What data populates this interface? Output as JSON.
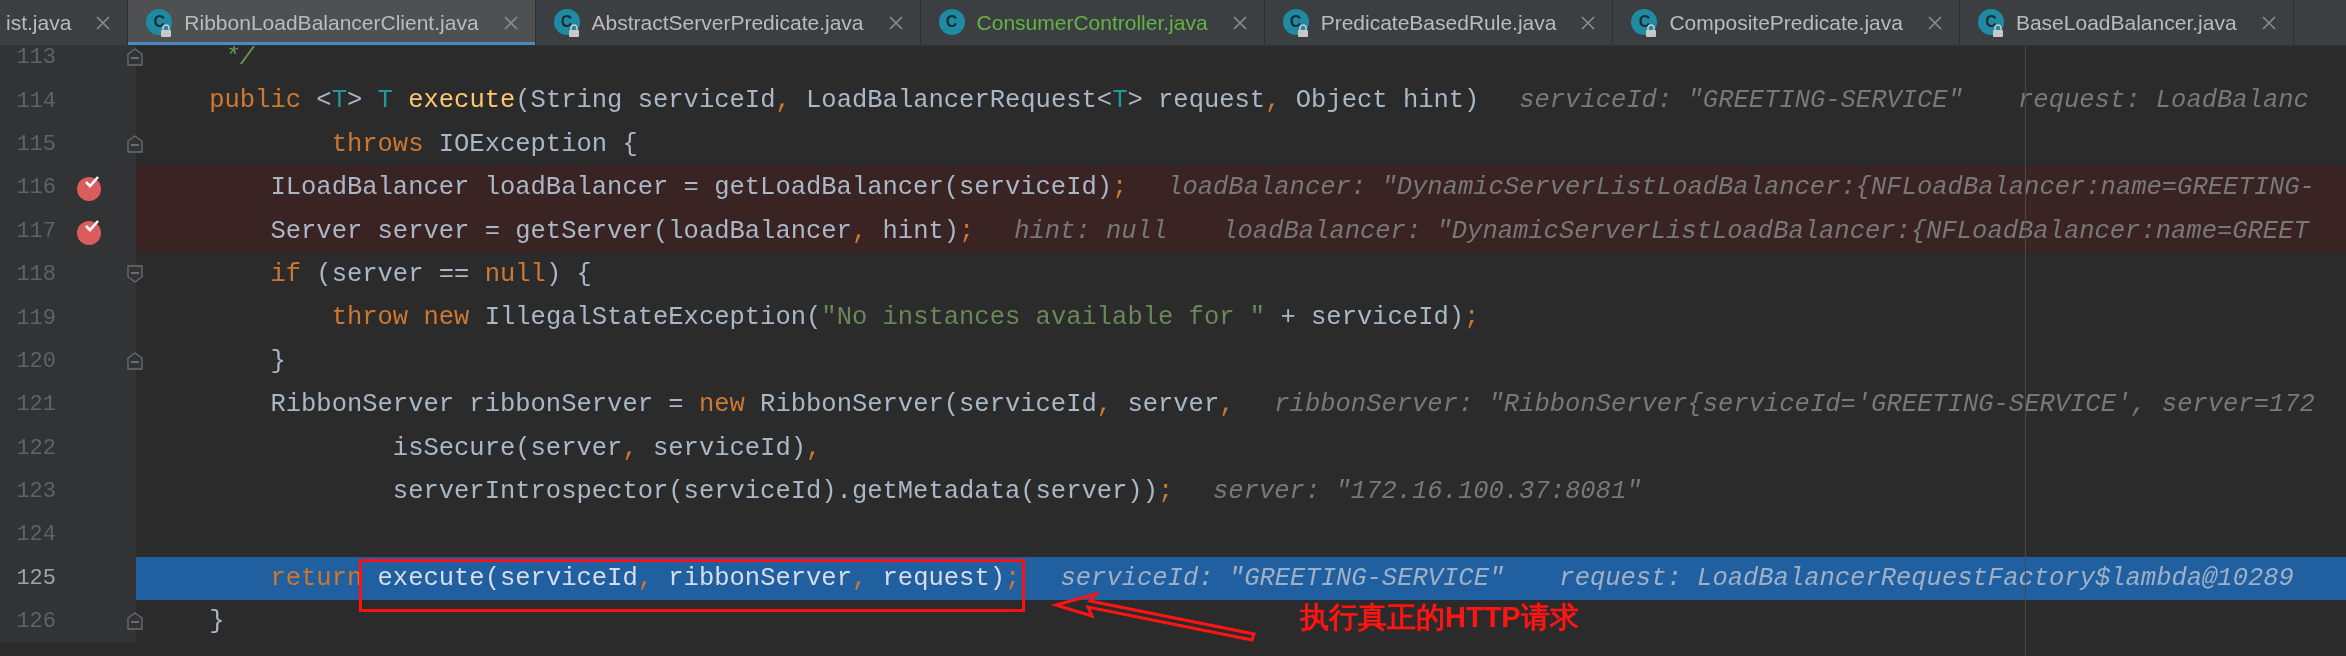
{
  "tabs": [
    {
      "label": "ist.java",
      "selected": false,
      "locked": false,
      "color": "#bbbbbb"
    },
    {
      "label": "RibbonLoadBalancerClient.java",
      "icon": "C",
      "selected": true,
      "locked": true,
      "color": "#bbbbbb"
    },
    {
      "label": "AbstractServerPredicate.java",
      "icon": "C",
      "selected": false,
      "locked": true,
      "color": "#bbbbbb"
    },
    {
      "label": "ConsumerController.java",
      "icon": "C",
      "selected": false,
      "locked": false,
      "color": "#62b543"
    },
    {
      "label": "PredicateBasedRule.java",
      "icon": "C",
      "selected": false,
      "locked": true,
      "color": "#bbbbbb"
    },
    {
      "label": "CompositePredicate.java",
      "icon": "C",
      "selected": false,
      "locked": true,
      "color": "#bbbbbb"
    },
    {
      "label": "BaseLoadBalancer.java",
      "icon": "C",
      "selected": false,
      "locked": true,
      "color": "#bbbbbb"
    }
  ],
  "editor": {
    "lines": [
      {
        "number": "113",
        "current": false,
        "breakpoint": false,
        "fold_start": false,
        "fold_end": true,
        "tokens": [
          {
            "t": "     */",
            "kind": "comment"
          }
        ]
      },
      {
        "number": "114",
        "current": false,
        "breakpoint": false,
        "fold_start": false,
        "fold_end": false,
        "tokens": [
          {
            "t": "    public",
            "kind": "kw"
          },
          {
            "t": " <",
            "kind": "plain"
          },
          {
            "t": "T",
            "kind": "tp"
          },
          {
            "t": "> ",
            "kind": "plain"
          },
          {
            "t": "T",
            "kind": "tp"
          },
          {
            "t": " execute",
            "kind": "fn"
          },
          {
            "t": "(String serviceId",
            "kind": "plain"
          },
          {
            "t": ",",
            "kind": "punct"
          },
          {
            "t": " LoadBalancerRequest<",
            "kind": "plain"
          },
          {
            "t": "T",
            "kind": "tp"
          },
          {
            "t": "> request",
            "kind": "plain"
          },
          {
            "t": ",",
            "kind": "punct"
          },
          {
            "t": " Object hint)",
            "kind": "plain"
          }
        ],
        "hints": [
          "serviceId: \"GREETING-SERVICE\"",
          "request: LoadBalanc"
        ]
      },
      {
        "number": "115",
        "current": false,
        "breakpoint": false,
        "fold_start": false,
        "fold_end": true,
        "tokens": [
          {
            "t": "            throws",
            "kind": "kw"
          },
          {
            "t": " IOException {",
            "kind": "plain"
          }
        ]
      },
      {
        "number": "116",
        "current": false,
        "breakpoint": true,
        "fold_start": false,
        "fold_end": false,
        "tokens": [
          {
            "t": "        ILoadBalancer loadBalancer = getLoadBalancer(serviceId)",
            "kind": "plain"
          },
          {
            "t": ";",
            "kind": "punct"
          }
        ],
        "hints": [
          "loadBalancer: \"DynamicServerListLoadBalancer:{NFLoadBalancer:name=GREETING-"
        ]
      },
      {
        "number": "117",
        "current": false,
        "breakpoint": true,
        "fold_start": false,
        "fold_end": false,
        "tokens": [
          {
            "t": "        Server server = getServer(loadBalancer",
            "kind": "plain"
          },
          {
            "t": ",",
            "kind": "punct"
          },
          {
            "t": " hint)",
            "kind": "plain"
          },
          {
            "t": ";",
            "kind": "punct"
          }
        ],
        "hints": [
          "hint: null",
          "loadBalancer: \"DynamicServerListLoadBalancer:{NFLoadBalancer:name=GREET"
        ]
      },
      {
        "number": "118",
        "current": false,
        "breakpoint": false,
        "fold_start": true,
        "fold_end": false,
        "tokens": [
          {
            "t": "        if",
            "kind": "kw"
          },
          {
            "t": " (server == ",
            "kind": "plain"
          },
          {
            "t": "null",
            "kind": "kw"
          },
          {
            "t": ") {",
            "kind": "plain"
          }
        ]
      },
      {
        "number": "119",
        "current": false,
        "breakpoint": false,
        "fold_start": false,
        "fold_end": false,
        "tokens": [
          {
            "t": "            throw",
            "kind": "kw"
          },
          {
            "t": " new",
            "kind": "kw"
          },
          {
            "t": " IllegalStateException(",
            "kind": "plain"
          },
          {
            "t": "\"No instances available for \"",
            "kind": "str"
          },
          {
            "t": " + serviceId)",
            "kind": "plain"
          },
          {
            "t": ";",
            "kind": "punct"
          }
        ]
      },
      {
        "number": "120",
        "current": false,
        "breakpoint": false,
        "fold_start": false,
        "fold_end": true,
        "tokens": [
          {
            "t": "        }",
            "kind": "plain"
          }
        ]
      },
      {
        "number": "121",
        "current": false,
        "breakpoint": false,
        "fold_start": false,
        "fold_end": false,
        "tokens": [
          {
            "t": "        RibbonServer ribbonServer = ",
            "kind": "plain"
          },
          {
            "t": "new",
            "kind": "kw"
          },
          {
            "t": " RibbonServer(serviceId",
            "kind": "plain"
          },
          {
            "t": ",",
            "kind": "punct"
          },
          {
            "t": " server",
            "kind": "plain"
          },
          {
            "t": ",",
            "kind": "punct"
          }
        ],
        "hints": [
          "ribbonServer: \"RibbonServer{serviceId='GREETING-SERVICE', server=172"
        ]
      },
      {
        "number": "122",
        "current": false,
        "breakpoint": false,
        "fold_start": false,
        "fold_end": false,
        "tokens": [
          {
            "t": "                isSecure(server",
            "kind": "plain"
          },
          {
            "t": ",",
            "kind": "punct"
          },
          {
            "t": " serviceId)",
            "kind": "plain"
          },
          {
            "t": ",",
            "kind": "punct"
          }
        ]
      },
      {
        "number": "123",
        "current": false,
        "breakpoint": false,
        "fold_start": false,
        "fold_end": false,
        "tokens": [
          {
            "t": "                serverIntrospector(serviceId).getMetadata(server))",
            "kind": "plain"
          },
          {
            "t": ";",
            "kind": "punct"
          }
        ],
        "hints": [
          "server: \"172.16.100.37:8081\""
        ]
      },
      {
        "number": "124",
        "current": false,
        "breakpoint": false,
        "fold_start": false,
        "fold_end": false
      },
      {
        "number": "125",
        "current": true,
        "breakpoint": false,
        "fold_start": false,
        "fold_end": false,
        "tokens": [
          {
            "t": "        return",
            "kind": "kw"
          },
          {
            "t": " execute(serviceId",
            "kind": "plain",
            "boxed": true
          },
          {
            "t": ",",
            "kind": "punct",
            "boxed": true
          },
          {
            "t": " ribbonServer",
            "kind": "plain",
            "boxed": true
          },
          {
            "t": ",",
            "kind": "punct",
            "boxed": true
          },
          {
            "t": " request)",
            "kind": "plain",
            "boxed": true
          },
          {
            "t": ";",
            "kind": "punct",
            "boxed": true
          }
        ],
        "hints": [
          "serviceId: \"GREETING-SERVICE\"",
          "request: LoadBalancerRequestFactory$lambda@10289"
        ]
      },
      {
        "number": "126",
        "current": false,
        "breakpoint": false,
        "fold_start": false,
        "fold_end": true,
        "tokens": [
          {
            "t": "    }",
            "kind": "plain"
          }
        ]
      }
    ],
    "callout": {
      "text": "执行真正的HTTP请求"
    }
  }
}
